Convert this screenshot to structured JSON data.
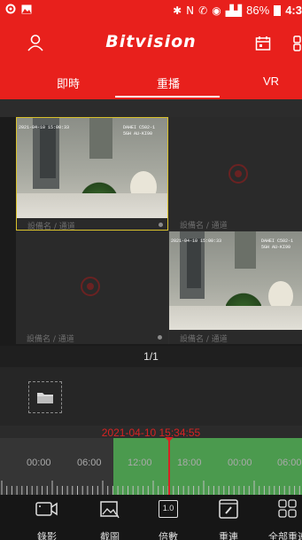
{
  "app": {
    "title": "Bitvision"
  },
  "status": {
    "battery": "86%",
    "clock": "4:3"
  },
  "tabs": [
    {
      "label": "即時"
    },
    {
      "label": "重播"
    },
    {
      "label": "VR"
    }
  ],
  "active_tab": "重播",
  "cameras": [
    {
      "label": "設備名 / 通道",
      "osd_time": "2021-04-10 15:00:33",
      "osd_name": "DAHEI C502-1",
      "osd_sub": "5GH AU-KI90",
      "has_video": true
    },
    {
      "label": "設備名 / 通道",
      "has_video": false
    },
    {
      "label": "設備名 / 通道",
      "has_video": false
    },
    {
      "label": "設備名 / 通道",
      "osd_time": "2021-04-10 15:00:33",
      "osd_name": "DAHEI C502-1",
      "osd_sub": "5GH AU-KI90",
      "has_video": true
    }
  ],
  "pagination": {
    "text": "1/1"
  },
  "playback": {
    "current_time": "2021-04-10 15:34:55",
    "tick_labels": [
      "00:00",
      "06:00",
      "12:00",
      "18:00",
      "00:00",
      "06:00"
    ]
  },
  "toolbar": {
    "record_label": "錄影",
    "snapshot_label": "截圖",
    "speed_label": "倍數",
    "speed_value": "1.0",
    "reconnect_label": "重連",
    "all_reconnect_label": "全部重連"
  },
  "colors": {
    "brand_red": "#e8201c",
    "timeline_green": "#4b9a4e",
    "cursor_red": "#d62323"
  }
}
